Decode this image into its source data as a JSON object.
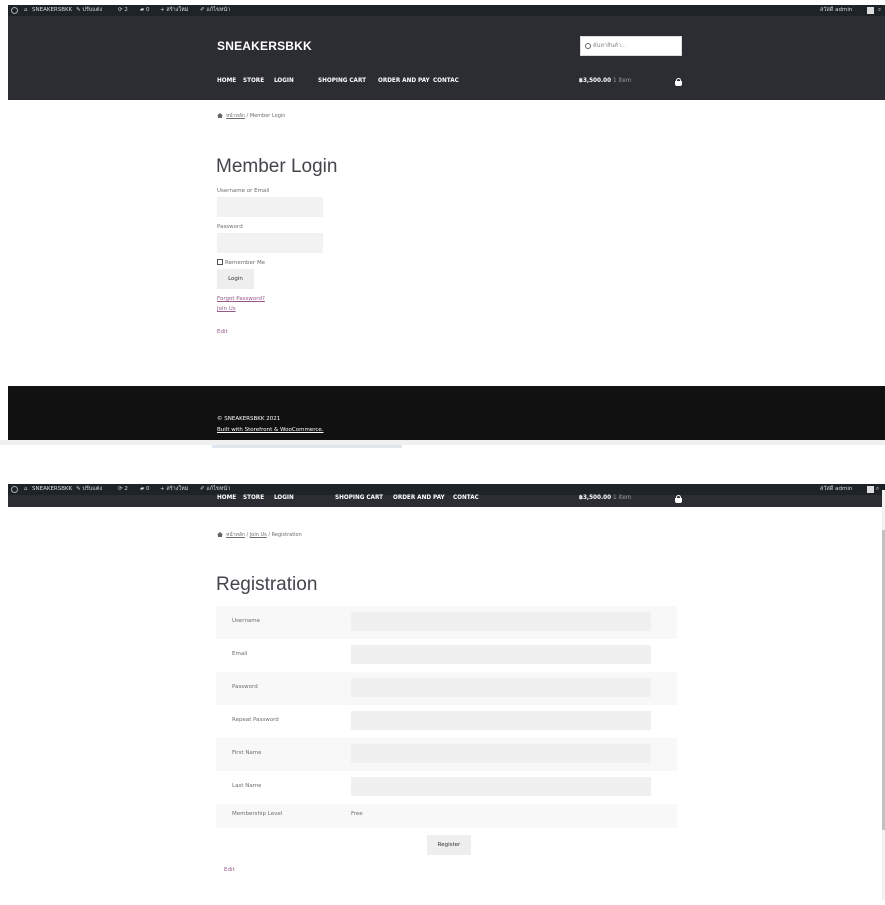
{
  "shot1": {
    "adminbar": {
      "site_name": "SNEAKERSBKK",
      "customize": "ปรับแต่ง",
      "updates": "2",
      "comments": "0",
      "new": "สร้างใหม่",
      "edit_page": "แก้ไขหน้า",
      "greeting": "สวัสดี admin"
    },
    "header": {
      "brand": "SNEAKERSBKK",
      "search_placeholder": "ค้นหาสินค้า..."
    },
    "nav": [
      "HOME",
      "STORE",
      "LOGIN",
      "SHOPING CART",
      "ORDER AND PAY",
      "CONTAC"
    ],
    "cart": {
      "amount": "฿3,500.00",
      "count": "1 item"
    },
    "breadcrumb": {
      "home": "หน้าหลัก",
      "current": "Member Login"
    },
    "page_title": "Member Login",
    "form": {
      "username_label": "Username or Email",
      "password_label": "Password",
      "remember_label": "Remember Me",
      "login_button": "Login",
      "forgot_link": "Forgot Password?",
      "join_link": "Join Us",
      "edit_link": "Edit"
    },
    "footer": {
      "copyright": "© SNEAKERSBKK 2021",
      "built_with": "Built with Storefront & WooCommerce."
    }
  },
  "shot2": {
    "adminbar": {
      "site_name": "SNEAKERSBKK",
      "customize": "ปรับแต่ง",
      "updates": "2",
      "comments": "0",
      "new": "สร้างใหม่",
      "edit_page": "แก้ไขหน้า",
      "greeting": "สวัสดี admin"
    },
    "nav": [
      "HOME",
      "STORE",
      "LOGIN",
      "SHOPING CART",
      "ORDER AND PAY",
      "CONTAC"
    ],
    "cart": {
      "amount": "฿3,500.00",
      "count": "1 item"
    },
    "breadcrumb": {
      "home": "หน้าหลัก",
      "parent": "Join Us",
      "current": "Registration"
    },
    "page_title": "Registration",
    "fields": [
      {
        "label": "Username"
      },
      {
        "label": "Email"
      },
      {
        "label": "Password"
      },
      {
        "label": "Repeat Password"
      },
      {
        "label": "First Name"
      },
      {
        "label": "Last Name"
      }
    ],
    "membership": {
      "label": "Membership Level",
      "value": "Free"
    },
    "register_button": "Register",
    "edit_link": "Edit"
  },
  "colors": {
    "header_bg": "#2c2d33",
    "footer_bg": "#111111",
    "adminbar_bg": "#1d2327",
    "link": "#96588a"
  }
}
